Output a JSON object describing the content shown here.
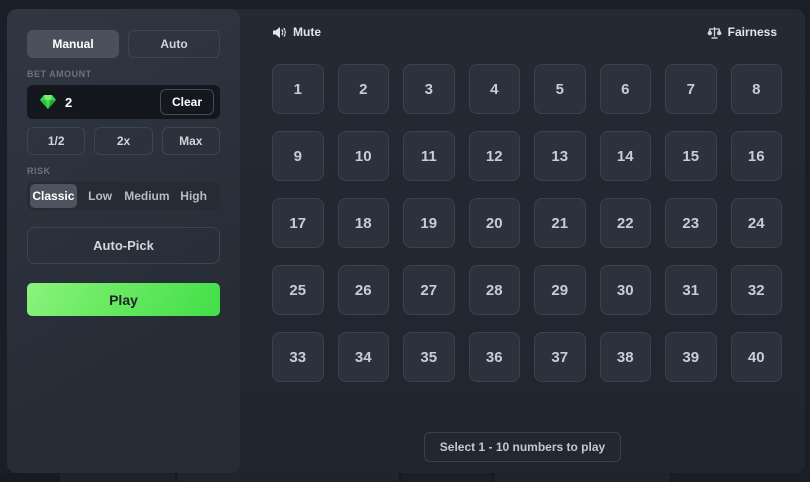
{
  "left_panel": {
    "tabs": {
      "manual": "Manual",
      "auto": "Auto",
      "active": "Manual"
    },
    "bet": {
      "label": "BET AMOUNT",
      "value": "2",
      "currency_icon": "green-gem-icon",
      "clear_label": "Clear",
      "half_label": "1/2",
      "double_label": "2x",
      "max_label": "Max"
    },
    "risk": {
      "label": "RISK",
      "options": [
        "Classic",
        "Low",
        "Medium",
        "High"
      ],
      "selected": "Classic"
    },
    "auto_pick_label": "Auto-Pick",
    "play_label": "Play"
  },
  "game": {
    "mute_label": "Mute",
    "mute_icon": "speaker-icon",
    "fairness_label": "Fairness",
    "fairness_icon": "scales-icon",
    "numbers": [
      1,
      2,
      3,
      4,
      5,
      6,
      7,
      8,
      9,
      10,
      11,
      12,
      13,
      14,
      15,
      16,
      17,
      18,
      19,
      20,
      21,
      22,
      23,
      24,
      25,
      26,
      27,
      28,
      29,
      30,
      31,
      32,
      33,
      34,
      35,
      36,
      37,
      38,
      39,
      40
    ],
    "grid_columns": 8,
    "helper_text": "Select 1 - 10 numbers to play"
  },
  "colors": {
    "page_background": "#1a1f27",
    "panel_background": "#2c323d",
    "game_background": "#22272f",
    "tile_background": "#2b323d",
    "tile_border": "#3a424e",
    "accent_green": "#45e04c",
    "play_gradient_light": "#8bf37d",
    "gem_green": "#3ddb4b",
    "active_chip": "#4a515c",
    "muted_label": "#6b7280"
  }
}
